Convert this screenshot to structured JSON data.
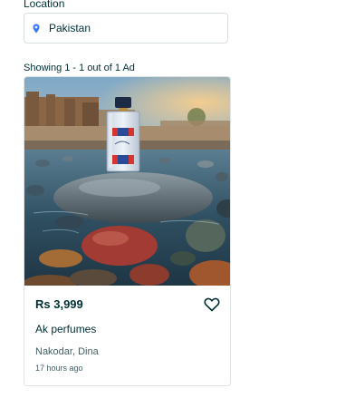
{
  "filters": {
    "location_label": "Location",
    "location_value": "Pakistan"
  },
  "results": {
    "count_text": "Showing 1 - 1 out of 1 Ad"
  },
  "ad": {
    "price": "Rs 3,999",
    "title": "Ak perfumes",
    "location": "Nakodar, Dina",
    "time": "17 hours ago",
    "image_alt": "perfume bottle on rock by river with fort in background"
  },
  "colors": {
    "text_primary": "#002f34",
    "text_secondary": "#406367",
    "border": "#d8dfe0",
    "pin_icon": "#3a77ff"
  }
}
